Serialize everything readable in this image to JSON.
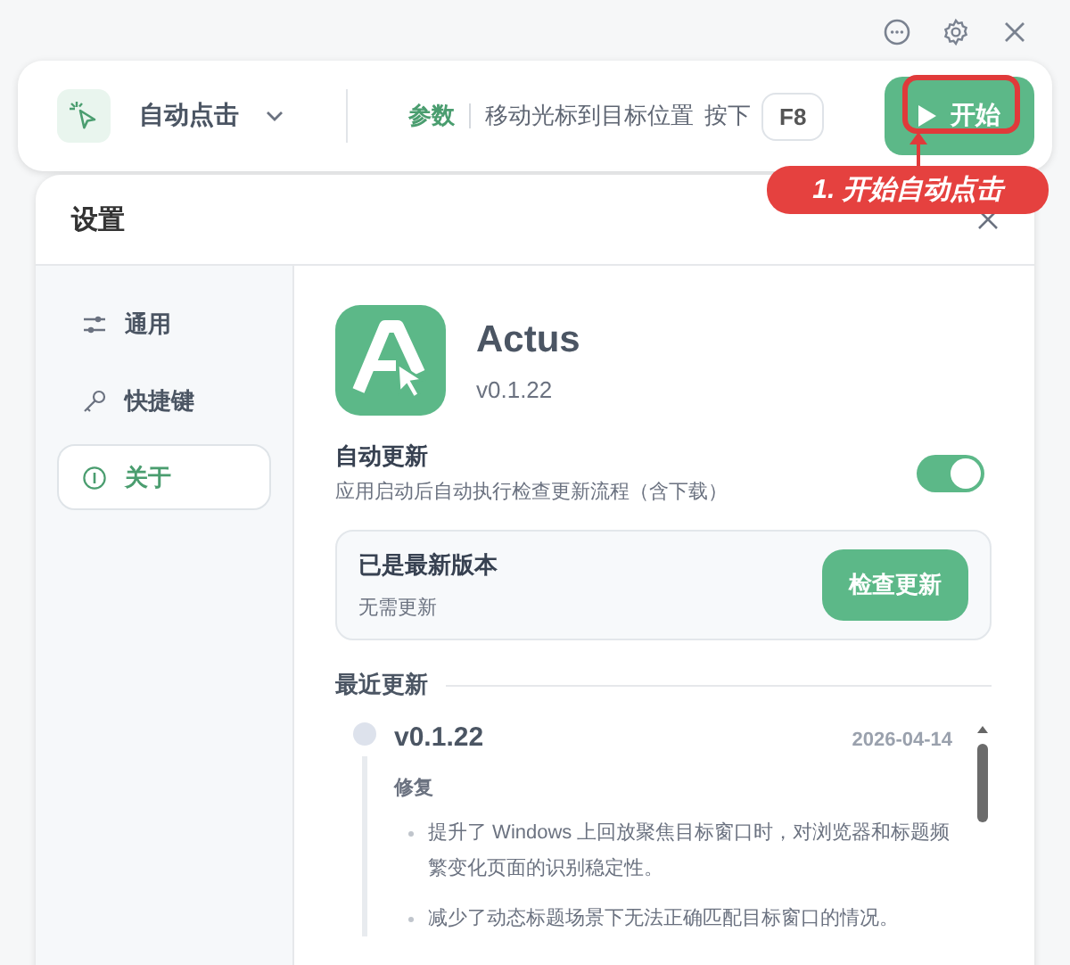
{
  "window_controls": [
    {
      "kind": "feedback"
    },
    {
      "kind": "settings"
    },
    {
      "kind": "close"
    }
  ],
  "toolbar": {
    "mode": "自动点击",
    "params_label": "参数",
    "hint": "移动光标到目标位置",
    "press_label": "按下",
    "hotkey": "F8",
    "start_button": "开始"
  },
  "annotation": {
    "text": "1. 开始自动点击"
  },
  "settings": {
    "title": "设置",
    "sidebar": {
      "items": [
        {
          "label": "通用",
          "kind": "sliders",
          "selected": false
        },
        {
          "label": "快捷键",
          "kind": "key",
          "selected": false
        },
        {
          "label": "关于",
          "kind": "info",
          "selected": true
        }
      ]
    },
    "about": {
      "app_name": "Actus",
      "version": "v0.1.22",
      "auto_update": {
        "label": "自动更新",
        "description": "应用启动后自动执行检查更新流程（含下载）",
        "on": true
      },
      "update_status": {
        "title": "已是最新版本",
        "subtitle": "无需更新",
        "button": "检查更新"
      },
      "recent_updates": {
        "title": "最近更新",
        "entries": [
          {
            "version": "v0.1.22",
            "date": "2026-04-14",
            "section": "修复",
            "items": [
              "提升了 Windows 上回放聚焦目标窗口时，对浏览器和标题频繁变化页面的识别稳定性。",
              "减少了动态标题场景下无法正确匹配目标窗口的情况。"
            ]
          }
        ]
      }
    }
  }
}
